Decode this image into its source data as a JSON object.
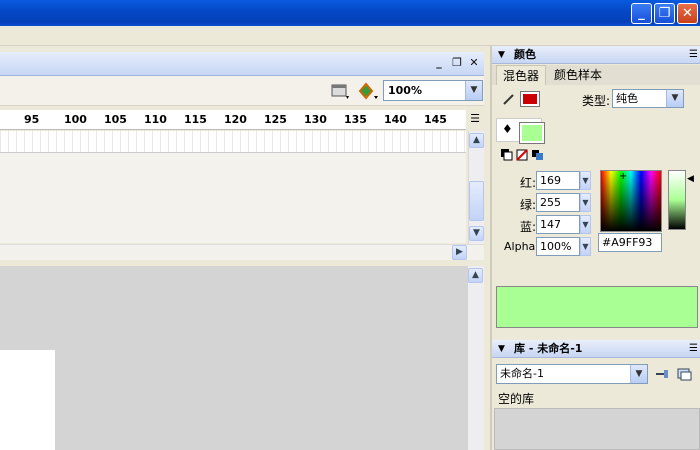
{
  "window": {
    "minimize_label": "_",
    "restore_label": "❐",
    "close_label": "✕"
  },
  "document": {
    "zoom_value": "100%",
    "ruler_ticks": [
      "95",
      "100",
      "105",
      "110",
      "115",
      "120",
      "125",
      "130",
      "135",
      "140",
      "145"
    ]
  },
  "color_panel": {
    "title": "颜色",
    "tabs": [
      "混色器",
      "颜色样本"
    ],
    "type_label": "类型:",
    "type_value": "纯色",
    "stroke_color": "#cc0000",
    "fill_color": "#A9FF93",
    "red_label": "红:",
    "red_value": "169",
    "green_label": "绿:",
    "green_value": "255",
    "blue_label": "蓝:",
    "blue_value": "147",
    "alpha_label": "Alpha:",
    "alpha_value": "100%",
    "hex_value": "#A9FF93"
  },
  "library_panel": {
    "title": "库 - 未命名-1",
    "selected_library": "未命名-1",
    "empty_text": "空的库"
  },
  "colors": {
    "titlebar": "#0548c8",
    "preview": "#A9FF93"
  }
}
